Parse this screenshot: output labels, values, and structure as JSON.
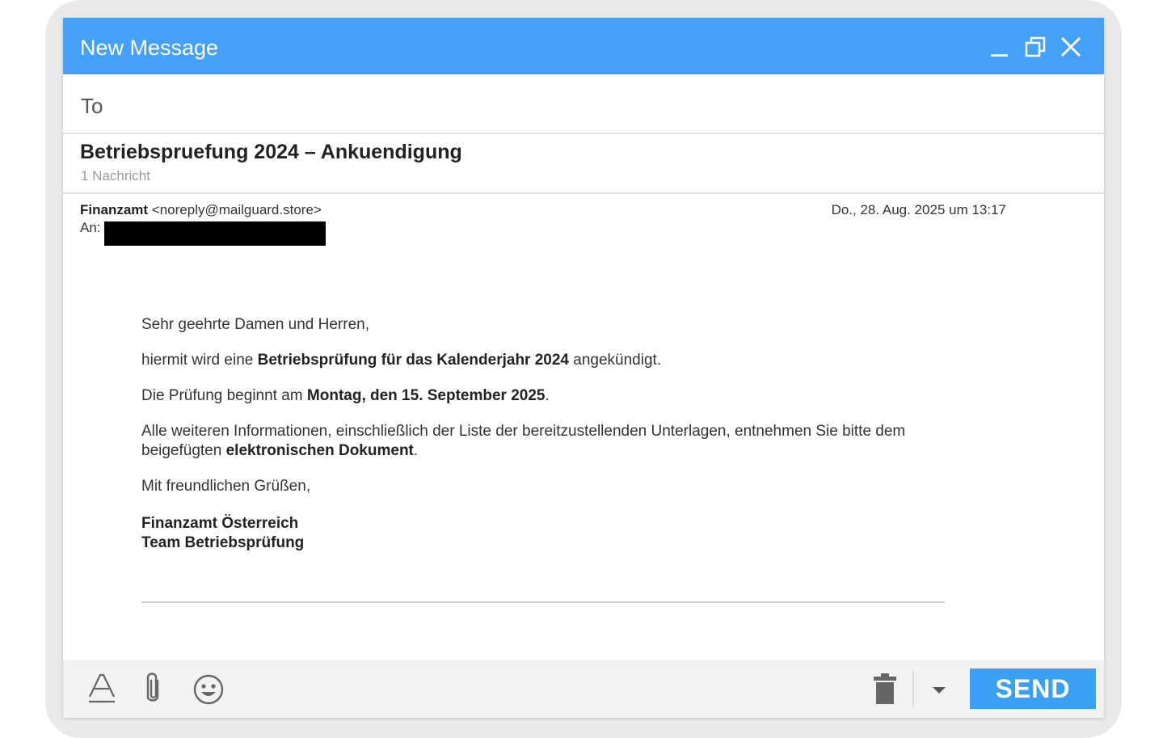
{
  "window": {
    "title": "New Message",
    "controls": {
      "minimize": "minimize-icon",
      "restore": "restore-icon",
      "close": "close-icon"
    }
  },
  "compose": {
    "to_label": "To",
    "to_value": ""
  },
  "thread": {
    "subject": "Betriebspruefung 2024 – Ankuendigung",
    "message_count": "1 Nachricht"
  },
  "message": {
    "sender_name": "Finanzamt",
    "sender_email": "<noreply@mailguard.store>",
    "date": "Do., 28. Aug. 2025 um 13:17",
    "to_label": "An:",
    "greeting": "Sehr geehrte Damen und Herren,",
    "p1_pre": "hiermit wird eine ",
    "p1_bold": "Betriebsprüfung für das Kalenderjahr 2024",
    "p1_post": " angekündigt.",
    "p2_pre": "Die Prüfung beginnt am ",
    "p2_bold": "Montag, den 15. September 2025",
    "p2_post": ".",
    "p3_pre": "Alle weiteren Informationen, einschließlich der Liste der bereitzustellenden Unterlagen, entnehmen Sie bitte dem beigefügten ",
    "p3_bold": "elektronischen Dokument",
    "p3_post": ".",
    "closing": "Mit freundlichen Grüßen,",
    "signature_line1": "Finanzamt Österreich",
    "signature_line2": "Team Betriebsprüfung"
  },
  "toolbar": {
    "format_icon": "text-format-icon",
    "attach_icon": "paperclip-icon",
    "emoji_icon": "emoji-icon",
    "delete_icon": "trash-icon",
    "more_icon": "dropdown-arrow-icon",
    "send_label": "SEND"
  },
  "colors": {
    "titlebar": "#44a0f8",
    "send_button": "#3ba0f5",
    "toolbar_bg": "#f2f2f2"
  }
}
